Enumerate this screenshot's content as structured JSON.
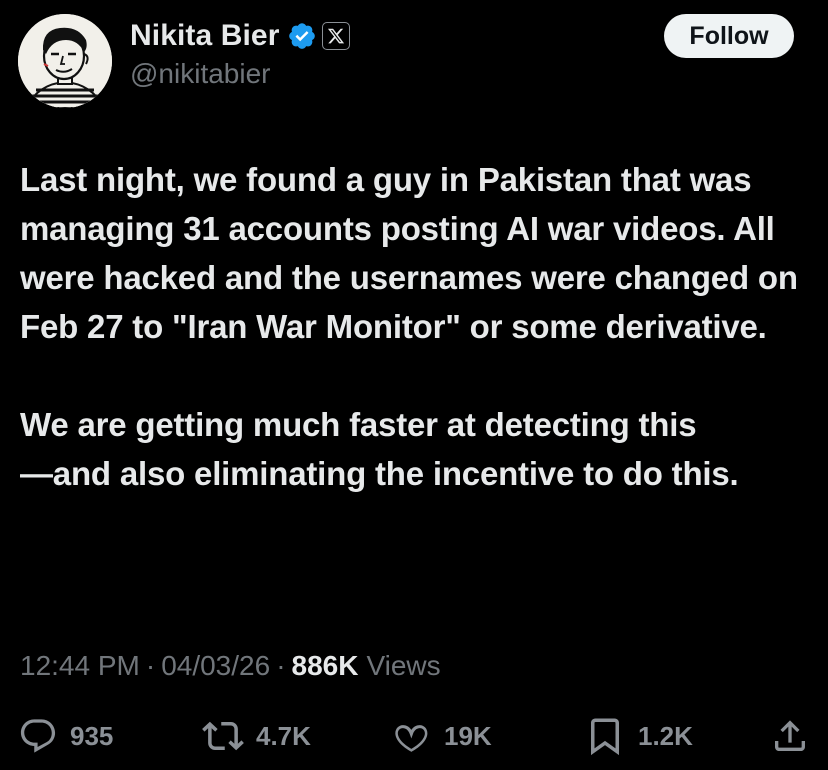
{
  "author": {
    "display_name": "Nikita Bier",
    "handle": "@nikitabier",
    "verified": true,
    "affiliate_badge": "x-logo-icon"
  },
  "follow_button": {
    "label": "Follow"
  },
  "tweet": {
    "paragraphs": [
      "Last night, we found a guy in Pakistan that was managing 31 accounts posting AI war videos. All were hacked and the usernames were changed on Feb 27 to \"Iran War Monitor\" or some derivative.",
      "We are getting much faster at detecting this\n—and also eliminating the incentive to do this."
    ]
  },
  "meta": {
    "time": "12:44 PM",
    "date": "04/03/26",
    "separator": "·",
    "views_count": "886K",
    "views_label": "Views"
  },
  "actions": {
    "replies": "935",
    "reposts": "4.7K",
    "likes": "19K",
    "bookmarks": "1.2K"
  },
  "colors": {
    "background": "#000000",
    "text_primary": "#e7e9ea",
    "text_secondary": "#71767b",
    "verified_blue": "#1d9bf0",
    "follow_bg": "#eff3f4"
  },
  "icons": {
    "reply": "speech-bubble-icon",
    "repost": "repost-arrows-icon",
    "like": "heart-icon",
    "bookmark": "bookmark-icon",
    "share": "share-upload-icon",
    "verified": "verified-badge-icon"
  }
}
